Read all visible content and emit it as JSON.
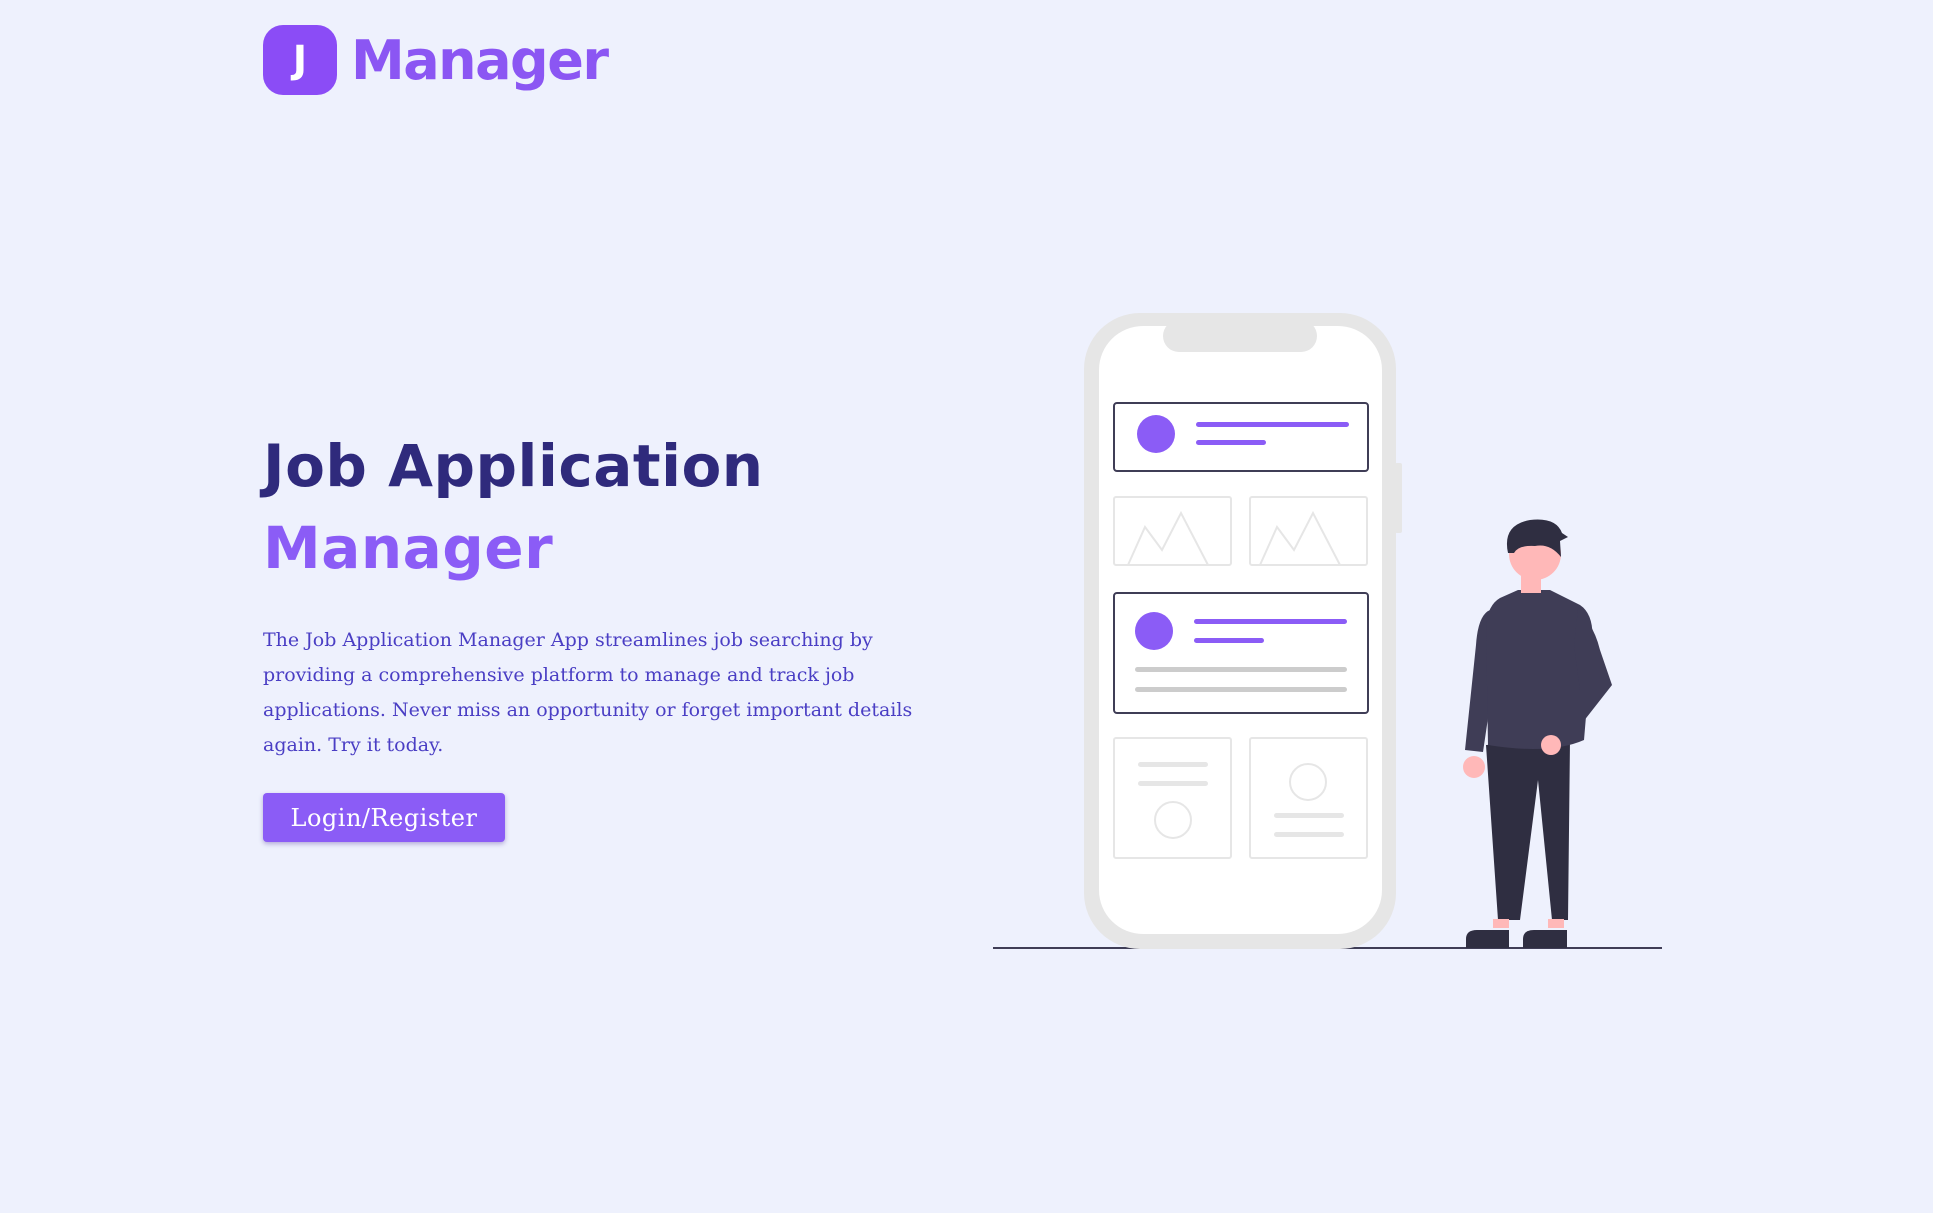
{
  "header": {
    "logo_letter": "J",
    "logo_text": "Manager"
  },
  "hero": {
    "title_line1": "Job Application",
    "title_line2": "Manager",
    "description": "The Job Application Manager App streamlines job searching by providing a comprehensive platform to manage and track job applications. Never miss an opportunity or forget important details again. Try it today.",
    "cta_label": "Login/Register"
  },
  "illustration": {
    "icon": "person-with-phone-illustration"
  },
  "colors": {
    "background": "#eef1fd",
    "accent": "#8b5cf6",
    "title_dark": "#2f2a7c",
    "body_text": "#4a3ec4",
    "figure_dark": "#3f3d56"
  }
}
